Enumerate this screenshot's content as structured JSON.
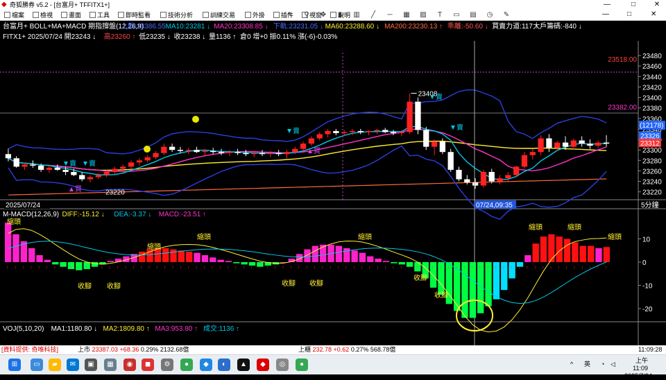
{
  "window": {
    "app_title": "奇狐勝券 v5.2 - [台富月+ TFFITX1+]",
    "controls": {
      "min": "—",
      "max": "□",
      "close": "✕"
    }
  },
  "menu": {
    "items": [
      "檔案",
      "檢視",
      "畫面",
      "工具",
      "即時監看",
      "技術分析",
      "訓練交易",
      "外掛",
      "插件",
      "視窗",
      "說明"
    ],
    "toolbar_icons": [
      "cursor-icon",
      "magnify-icon",
      "pan-icon",
      "candle-icon",
      "bar-icon",
      "line-icon",
      "minus-icon",
      "grid-icon",
      "image-icon",
      "text-icon",
      "rect-icon",
      "calendar-icon",
      "clock-icon",
      "pen-icon"
    ]
  },
  "chart": {
    "header_line1": [
      {
        "text": "台富月+ BOLL+MA+MACD 期指撐盤(12,26,9)",
        "color": "#ffffff"
      },
      {
        "text": "上軌:23386.55",
        "color": "#4a6bff"
      },
      {
        "text": "MA10:23281 ↓",
        "color": "#00c8e8"
      },
      {
        "text": "MA20:23308.85 ↓",
        "color": "#ff33cc"
      },
      {
        "text": "下軌:23231.05 ↓",
        "color": "#4a6bff"
      },
      {
        "text": "MA60:23288.60 ↓",
        "color": "#ffee33"
      },
      {
        "text": "MA200:23230.13 ↑",
        "color": "#ff6a3d"
      },
      {
        "text": "乖離:-50.60 ↓",
        "color": "#ff5555"
      },
      {
        "text": "買賣力道:117 ↑",
        "color": "#ffffff"
      },
      {
        "text": "大戶籌碼:-840 ↓",
        "color": "#ffffff"
      }
    ],
    "header_line2": [
      {
        "text": "FITX1+ 2025/07/24 開23243 ↓",
        "color": "#ffffff"
      },
      {
        "text": "高23260 ↑",
        "color": "#ff4444"
      },
      {
        "text": "低23235 ↓",
        "color": "#ffffff"
      },
      {
        "text": "收23238 ↓",
        "color": "#ffffff"
      },
      {
        "text": "量1136 ↑",
        "color": "#ffffff"
      },
      {
        "text": "倉0 增+0 振0.11% 漲(-6)-0.03%",
        "color": "#ffffff"
      }
    ],
    "price_axis": {
      "ticks": [
        23480,
        23460,
        23440,
        23420,
        23400,
        23380,
        23360,
        23340,
        23320,
        23300,
        23280,
        23260,
        23240,
        23220
      ],
      "min": 23205,
      "max": 23492
    },
    "price_markers": [
      {
        "label": "23518.00",
        "value": 23518,
        "color": "#ff4444"
      },
      {
        "label": "23382.00",
        "value": 23382,
        "color": "#ff33cc"
      },
      {
        "label": "(12178)",
        "value": 23345,
        "color": "#2266ff"
      },
      {
        "label": "23326",
        "value": 23326,
        "color": "#2266ff"
      },
      {
        "label": "23312",
        "value": 23312,
        "color": "#ff3333"
      }
    ],
    "annotations": {
      "high_label": "23408",
      "low_label": "23220",
      "date_left": "2025/07/24",
      "cursor_time": "07/24,09:35",
      "period": "5分鐘",
      "buy_label": "買",
      "sell_label": "賣",
      "warn_label": "!!"
    },
    "macd": {
      "header": [
        {
          "text": "M-MACD(12,26,9)",
          "color": "#ffffff"
        },
        {
          "text": "DIFF:-15.12 ↓",
          "color": "#ffee33"
        },
        {
          "text": "DEA:-3.37 ↓",
          "color": "#00c8e8"
        },
        {
          "text": "MACD:-23.51 ↑",
          "color": "#ff33cc"
        }
      ],
      "axis_ticks": [
        10,
        0,
        -10,
        -20
      ],
      "labels": {
        "shrink_head": "縮頭",
        "shrink_foot": "收腳"
      }
    },
    "vol": {
      "header": [
        {
          "text": "VOJ(5,10,20)",
          "color": "#ffffff"
        },
        {
          "text": "MA1:1180.80 ↓",
          "color": "#ffffff"
        },
        {
          "text": "MA2:1809.80 ↑",
          "color": "#ffee33"
        },
        {
          "text": "MA3:953.80 ↑",
          "color": "#ff33cc"
        },
        {
          "text": "成交:1136 ↑",
          "color": "#00c8e8"
        }
      ]
    },
    "colors": {
      "up": "#ff2222",
      "down": "#ffffff",
      "ma10": "#00c8e8",
      "ma20": "#ff33cc",
      "ma60": "#ffee33",
      "ma200": "#ff6a3d",
      "boll": "#2233cc",
      "macd_pos": "#ff22cc",
      "macd_pos_strong": "#ff1111",
      "macd_neg": "#00ff44",
      "macd_neg_b": "#00e0ff"
    }
  },
  "chart_data": {
    "type": "candlestick",
    "candles": [
      [
        23292,
        23302,
        23278,
        23284
      ],
      [
        23284,
        23288,
        23266,
        23268
      ],
      [
        23268,
        23276,
        23262,
        23272
      ],
      [
        23272,
        23280,
        23266,
        23270
      ],
      [
        23270,
        23274,
        23258,
        23262
      ],
      [
        23262,
        23270,
        23256,
        23266
      ],
      [
        23266,
        23272,
        23260,
        23262
      ],
      [
        23262,
        23268,
        23252,
        23258
      ],
      [
        23258,
        23264,
        23250,
        23252
      ],
      [
        23252,
        23258,
        23240,
        23244
      ],
      [
        23244,
        23252,
        23238,
        23248
      ],
      [
        23248,
        23256,
        23244,
        23252
      ],
      [
        23252,
        23262,
        23248,
        23258
      ],
      [
        23258,
        23268,
        23254,
        23264
      ],
      [
        23264,
        23272,
        23256,
        23268
      ],
      [
        23268,
        23280,
        23262,
        23276
      ],
      [
        23276,
        23284,
        23270,
        23280
      ],
      [
        23280,
        23290,
        23276,
        23286
      ],
      [
        23286,
        23298,
        23282,
        23294
      ],
      [
        23294,
        23312,
        23290,
        23306
      ],
      [
        23306,
        23312,
        23296,
        23300
      ],
      [
        23300,
        23306,
        23294,
        23298
      ],
      [
        23298,
        23304,
        23292,
        23300
      ],
      [
        23300,
        23306,
        23294,
        23296
      ],
      [
        23296,
        23302,
        23290,
        23298
      ],
      [
        23298,
        23304,
        23292,
        23296
      ],
      [
        23296,
        23302,
        23290,
        23294
      ],
      [
        23294,
        23300,
        23288,
        23296
      ],
      [
        23296,
        23302,
        23290,
        23294
      ],
      [
        23294,
        23300,
        23288,
        23292
      ],
      [
        23292,
        23298,
        23286,
        23294
      ],
      [
        23294,
        23300,
        23288,
        23292
      ],
      [
        23292,
        23298,
        23286,
        23294
      ],
      [
        23294,
        23300,
        23288,
        23292
      ],
      [
        23292,
        23300,
        23284,
        23296
      ],
      [
        23296,
        23306,
        23292,
        23302
      ],
      [
        23302,
        23316,
        23298,
        23312
      ],
      [
        23312,
        23326,
        23308,
        23322
      ],
      [
        23322,
        23334,
        23318,
        23330
      ],
      [
        23330,
        23340,
        23324,
        23336
      ],
      [
        23336,
        23340,
        23328,
        23332
      ],
      [
        23332,
        23338,
        23326,
        23334
      ],
      [
        23334,
        23340,
        23328,
        23336
      ],
      [
        23336,
        23340,
        23330,
        23334
      ],
      [
        23334,
        23338,
        23328,
        23336
      ],
      [
        23336,
        23340,
        23330,
        23338
      ],
      [
        23338,
        23342,
        23332,
        23334
      ],
      [
        23334,
        23338,
        23328,
        23332
      ],
      [
        23332,
        23338,
        23326,
        23334
      ],
      [
        23334,
        23408,
        23330,
        23392
      ],
      [
        23392,
        23400,
        23330,
        23338
      ],
      [
        23338,
        23344,
        23300,
        23306
      ],
      [
        23306,
        23320,
        23290,
        23316
      ],
      [
        23316,
        23322,
        23292,
        23296
      ],
      [
        23296,
        23302,
        23258,
        23262
      ],
      [
        23262,
        23268,
        23240,
        23244
      ],
      [
        23244,
        23252,
        23234,
        23238
      ],
      [
        23238,
        23246,
        23226,
        23232
      ],
      [
        23232,
        23262,
        23228,
        23258
      ],
      [
        23258,
        23264,
        23236,
        23240
      ],
      [
        23240,
        23252,
        23234,
        23246
      ],
      [
        23246,
        23258,
        23240,
        23252
      ],
      [
        23252,
        23270,
        23248,
        23268
      ],
      [
        23268,
        23296,
        23264,
        23290
      ],
      [
        23290,
        23302,
        23282,
        23296
      ],
      [
        23296,
        23328,
        23290,
        23322
      ],
      [
        23322,
        23330,
        23296,
        23304
      ],
      [
        23304,
        23318,
        23298,
        23314
      ],
      [
        23314,
        23326,
        23300,
        23306
      ],
      [
        23306,
        23322,
        23300,
        23318
      ],
      [
        23318,
        23326,
        23306,
        23312
      ],
      [
        23312,
        23320,
        23302,
        23308
      ],
      [
        23308,
        23318,
        23304,
        23314
      ],
      [
        23314,
        23328,
        23306,
        23312
      ]
    ],
    "macd_hist": [
      17,
      12,
      9,
      6,
      3,
      1,
      -1,
      -2,
      -3,
      -3.5,
      -3,
      -2,
      -1,
      0.5,
      1.5,
      2.5,
      3.5,
      4.5,
      5.5,
      6,
      6,
      5.5,
      5,
      4.5,
      4,
      3,
      2,
      1,
      0.5,
      -0.5,
      -1,
      -1.5,
      -2,
      -1.5,
      -1,
      0,
      1.5,
      3.5,
      5.5,
      7,
      7.5,
      7.5,
      7,
      6,
      5,
      4,
      2.5,
      1.5,
      0.5,
      -0.5,
      -1,
      -2,
      -4,
      -7,
      -11,
      -14,
      -18,
      -21,
      -24,
      -24,
      -22,
      -19,
      -16,
      -12,
      -7,
      -2,
      3,
      8,
      11,
      12,
      11,
      10,
      8.5,
      7,
      7,
      6,
      6.5
    ]
  }
}
